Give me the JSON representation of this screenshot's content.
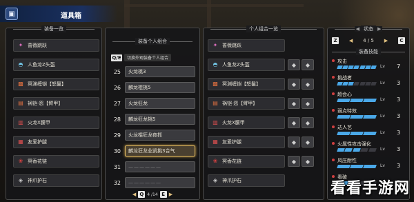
{
  "header": {
    "icon": "item-box-icon",
    "title": "道具箱"
  },
  "equipment_panel": {
    "title": "装备一览",
    "items": [
      {
        "icon": "weapon-icon",
        "icon_color": "#e070c0",
        "label": "蔷薇跳跃"
      },
      {
        "icon": "helmet-icon",
        "icon_color": "#70c0e0",
        "label": "人鱼龙Z头盔"
      },
      {
        "icon": "chest-icon",
        "icon_color": "#e07040",
        "label": "冥渊缠铠【怒鬣】"
      },
      {
        "icon": "arms-icon",
        "icon_color": "#e07040",
        "label": "祸铠·怨【臂甲】"
      },
      {
        "icon": "waist-icon",
        "icon_color": "#e05050",
        "label": "火龙X腰甲"
      },
      {
        "icon": "legs-icon",
        "icon_color": "#e05050",
        "label": "友爱护腿"
      },
      {
        "icon": "charm-icon",
        "icon_color": "#d04040",
        "label": "冥香花链"
      },
      {
        "icon": "mantle-icon",
        "icon_color": "#d0d0d0",
        "label": "神爪护石"
      }
    ]
  },
  "sets_panel": {
    "title": "装备个人组合",
    "hint_button": "Q/E",
    "hint_text": "切换外观装备个人组合",
    "sets": [
      {
        "num": "25",
        "label": "火龙桃3"
      },
      {
        "num": "26",
        "label": "麟龙棍挑5"
      },
      {
        "num": "27",
        "label": "火龙狂龙"
      },
      {
        "num": "28",
        "label": "麟龙狂龙挑5"
      },
      {
        "num": "29",
        "label": "火龙棍狂龙夜抓"
      },
      {
        "num": "30",
        "label": "麟龙狂龙业凯挑3合气",
        "selected": true
      },
      {
        "num": "31",
        "label": "——————"
      },
      {
        "num": "32",
        "label": "——————"
      }
    ],
    "page_left": "Q",
    "page_text": "4 /14",
    "page_right": "E"
  },
  "personal_panel": {
    "title": "个人组合一览",
    "items": [
      {
        "icon": "weapon-icon",
        "icon_color": "#e070c0",
        "label": "蔷薇跳跃",
        "decos": 0
      },
      {
        "icon": "helmet-icon",
        "icon_color": "#70c0e0",
        "label": "人鱼龙Z头盔",
        "decos": 2
      },
      {
        "icon": "chest-icon",
        "icon_color": "#e07040",
        "label": "冥渊缠铠【怒鬣】",
        "decos": 2
      },
      {
        "icon": "arms-icon",
        "icon_color": "#e07040",
        "label": "祸铠·怨【臂甲】",
        "decos": 2
      },
      {
        "icon": "waist-icon",
        "icon_color": "#e05050",
        "label": "火龙X腰甲",
        "decos": 2
      },
      {
        "icon": "legs-icon",
        "icon_color": "#e05050",
        "label": "友爱护腿",
        "decos": 2
      },
      {
        "icon": "charm-icon",
        "icon_color": "#d04040",
        "label": "冥香花链",
        "decos": 2
      },
      {
        "icon": "mantle-icon",
        "icon_color": "#d0d0d0",
        "label": "神爪护石",
        "decos": 0
      }
    ],
    "deco_glyph": "◆"
  },
  "status_panel": {
    "title": "状态",
    "nav_left": "Z",
    "page_text": "4 / 5",
    "nav_right": "C",
    "skill_header": "装备技能",
    "skills": [
      {
        "name": "攻击",
        "pips_total": 7,
        "pips_on": 7,
        "lv_label": "Lv",
        "lv": "7"
      },
      {
        "name": "挑战者",
        "pips_total": 7,
        "pips_on": 3,
        "lv_label": "Lv",
        "lv": "3"
      },
      {
        "name": "超会心",
        "pips_total": 3,
        "pips_on": 3,
        "lv_label": "Lv",
        "lv": "3"
      },
      {
        "name": "弱点特效",
        "pips_total": 3,
        "pips_on": 3,
        "lv_label": "Lv",
        "lv": "3"
      },
      {
        "name": "达人艺",
        "pips_total": 3,
        "pips_on": 3,
        "lv_label": "Lv",
        "lv": "3"
      },
      {
        "name": "火属性攻击强化",
        "pips_total": 5,
        "pips_on": 3,
        "lv_label": "Lv",
        "lv": "3"
      },
      {
        "name": "风压耐性",
        "pips_total": 3,
        "pips_on": 3,
        "lv_label": "Lv",
        "lv": "3"
      },
      {
        "name": "看破",
        "pips_total": 7,
        "pips_on": 2,
        "lv_label": "Lv",
        "lv": "2"
      }
    ]
  },
  "watermark": "看看手游网"
}
